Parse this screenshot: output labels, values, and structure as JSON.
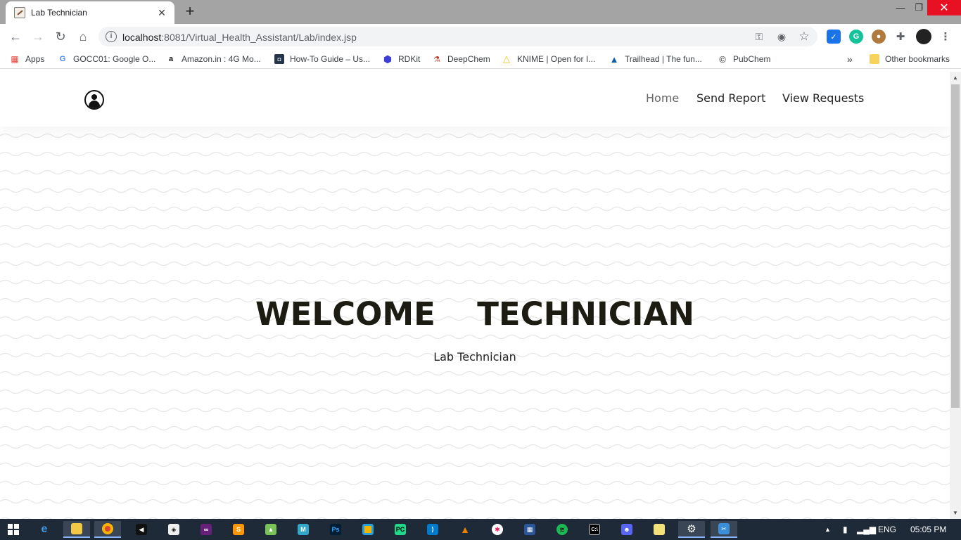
{
  "browser": {
    "tab_title": "Lab Technician",
    "new_tab_symbol": "+",
    "close_tab_symbol": "✕",
    "url_host": "localhost",
    "url_path": ":8081/Virtual_Health_Assistant/Lab/index.jsp"
  },
  "bookmarks": {
    "items": [
      {
        "label": "Apps",
        "icon": "apps-grid-icon"
      },
      {
        "label": "GOCC01: Google O...",
        "icon": "google-icon"
      },
      {
        "label": "Amazon.in : 4G Mo...",
        "icon": "amazon-icon"
      },
      {
        "label": "How-To Guide – Us...",
        "icon": "guide-icon"
      },
      {
        "label": "RDKit",
        "icon": "rdkit-icon"
      },
      {
        "label": "DeepChem",
        "icon": "deepchem-icon"
      },
      {
        "label": "KNIME | Open for I...",
        "icon": "knime-icon"
      },
      {
        "label": "Trailhead | The fun...",
        "icon": "trailhead-icon"
      },
      {
        "label": "PubChem",
        "icon": "pubchem-icon"
      }
    ],
    "overflow": "»",
    "other": "Other bookmarks"
  },
  "site": {
    "nav": {
      "home": "Home",
      "send_report": "Send Report",
      "view_requests": "View Requests"
    },
    "hero": {
      "title": "WELCOME  TECHNICIAN",
      "subtitle": "Lab Technician"
    }
  },
  "taskbar": {
    "language": "ENG",
    "time": "05:05 PM"
  },
  "colors": {
    "accent_close": "#e81123",
    "title_text": "#1c1c12",
    "taskbar": "#1f2a38"
  }
}
